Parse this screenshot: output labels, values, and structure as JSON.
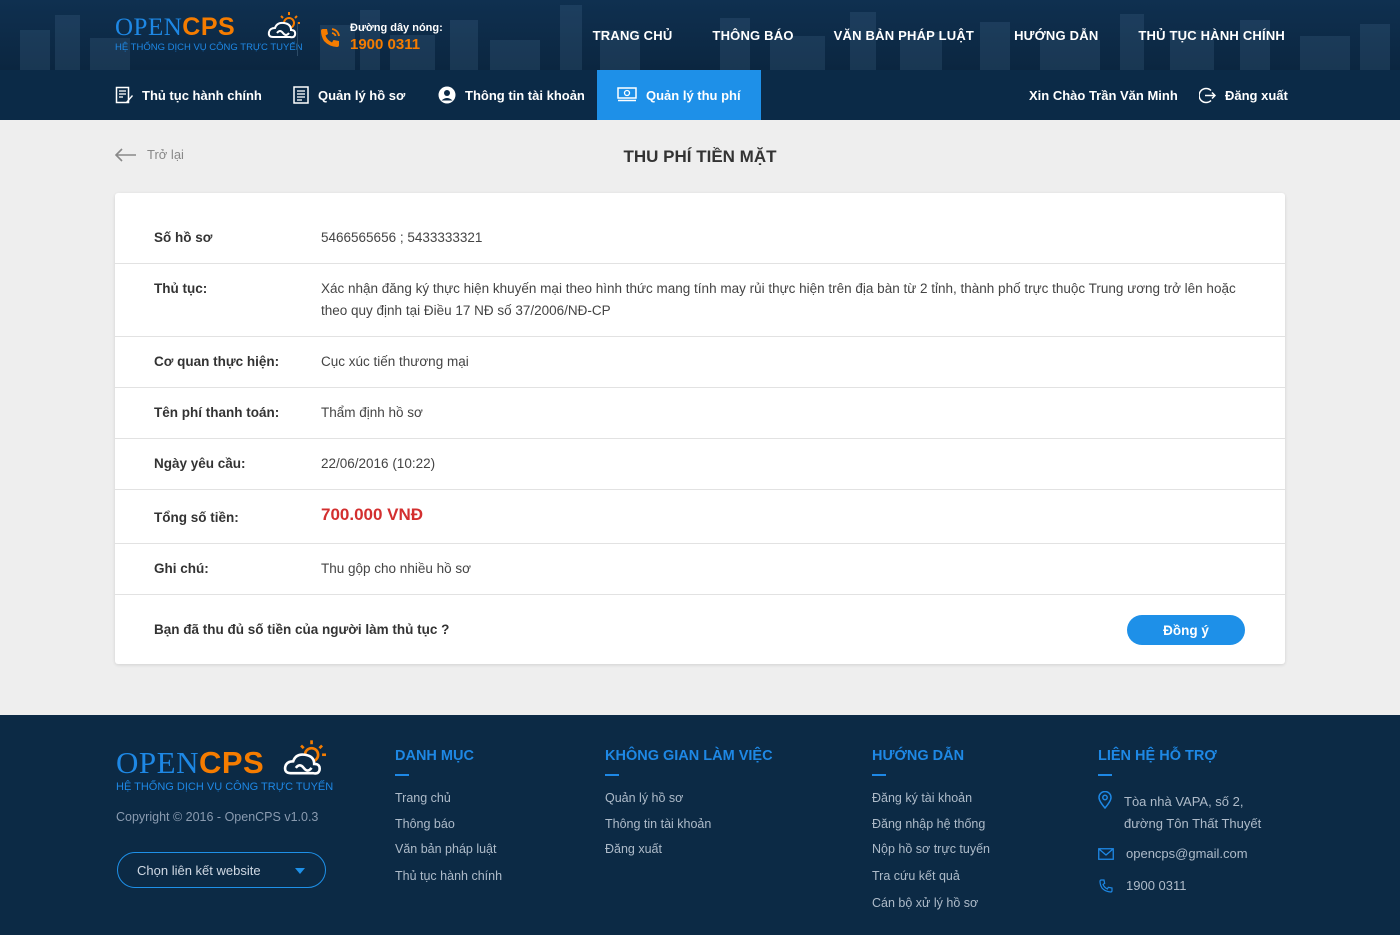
{
  "brand": {
    "logo_open": "OPEN",
    "logo_cps": "CPS",
    "logo_sub": "HỆ THỐNG DỊCH VỤ CÔNG TRỰC TUYẾN",
    "primary_color": "#1e90e8",
    "accent_color": "#f57c00",
    "navy_color": "#0c2a45"
  },
  "hotline": {
    "label": "Đường dây nóng:",
    "number": "1900 0311",
    "icon": "phone-icon"
  },
  "main_nav": [
    "TRANG CHỦ",
    "THÔNG BÁO",
    "VĂN BẢN PHÁP LUẬT",
    "HƯỚNG DẪN",
    "THỦ TỤC HÀNH CHÍNH"
  ],
  "sub_nav": {
    "items": [
      {
        "label": "Thủ tục hành chính",
        "icon": "document-edit-icon"
      },
      {
        "label": "Quản lý hồ sơ",
        "icon": "file-list-icon"
      },
      {
        "label": "Thông tin tài khoản",
        "icon": "user-circle-icon"
      },
      {
        "label": "Quản lý thu phí",
        "icon": "money-icon",
        "active": true
      }
    ],
    "greeting": "Xin Chào Trần Văn Minh",
    "logout": "Đăng xuất"
  },
  "page": {
    "back_label": "Trở lại",
    "title": "THU PHÍ TIỀN MẶT"
  },
  "details": {
    "so_ho_so": {
      "label": "Số hồ sơ",
      "value": "5466565656 ; 5433333321"
    },
    "thu_tuc": {
      "label": "Thủ tục:",
      "value": "Xác nhận đăng ký thực hiện khuyến mại theo hình thức mang tính may rủi thực hiện trên địa bàn từ 2 tỉnh, thành phố trực thuộc Trung ương trở lên hoặc theo quy định tại Điều 17 NĐ số 37/2006/NĐ-CP"
    },
    "co_quan": {
      "label": "Cơ quan thực hiện:",
      "value": "Cục xúc tiến thương mại"
    },
    "ten_phi": {
      "label": "Tên phí thanh toán:",
      "value": "Thẩm định hồ sơ"
    },
    "ngay_yeu_cau": {
      "label": "Ngày yêu cầu:",
      "value": "22/06/2016 (10:22)"
    },
    "tong_tien": {
      "label": "Tổng số tiền:",
      "value": "700.000 VNĐ"
    },
    "ghi_chu": {
      "label": "Ghi chú:",
      "value": "Thu gộp cho nhiều hồ sơ"
    }
  },
  "confirm": {
    "question": "Bạn đã thu đủ số tiền của người làm thủ tục ?",
    "button": "Đồng ý"
  },
  "footer": {
    "copyright": "Copyright © 2016 - OpenCPS v1.0.3",
    "select_label": "Chọn liên kết website",
    "danh_muc": {
      "title": "DANH MỤC",
      "links": [
        "Trang chủ",
        "Thông báo",
        "Văn bản pháp luật",
        "Thủ tục hành chính"
      ]
    },
    "khong_gian": {
      "title": "KHÔNG GIAN LÀM VIỆC",
      "links": [
        "Quản lý hồ sơ",
        "Thông tin tài khoản",
        "Đăng xuất"
      ]
    },
    "huong_dan": {
      "title": "HƯỚNG DẪN",
      "links": [
        "Đăng ký tài khoản",
        "Đăng nhập hệ thống",
        "Nộp hồ sơ trực tuyến",
        "Tra cứu kết quả",
        "Cán bộ xử lý hồ sơ"
      ]
    },
    "lien_he": {
      "title": "LIÊN HỆ HỖ TRỢ",
      "address_line1": "Tòa nhà VAPA, số 2,",
      "address_line2": "đường Tôn Thất Thuyết",
      "email": "opencps@gmail.com",
      "phone": "1900 0311"
    }
  }
}
